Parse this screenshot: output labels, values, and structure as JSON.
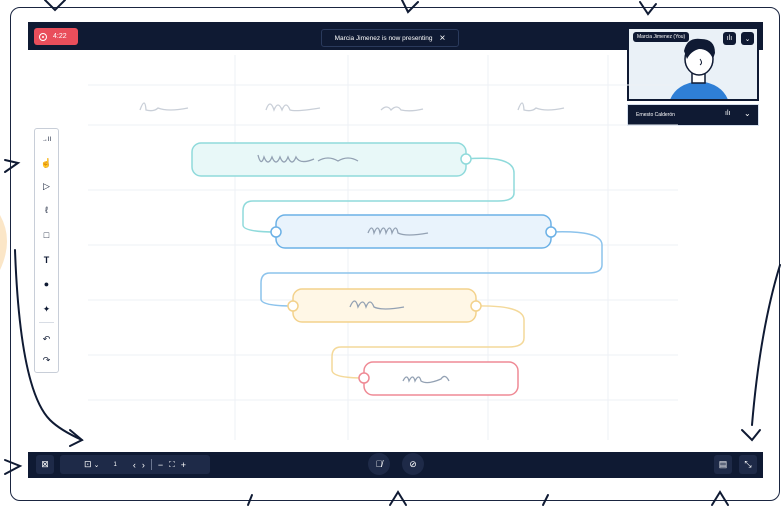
{
  "recording": {
    "time": "4:22"
  },
  "notification": {
    "text": "Marcia Jimenez is now presenting",
    "close_icon": "×"
  },
  "participants": [
    {
      "name": "Marcia Jimenez (You)"
    },
    {
      "name": "Ernesto Calderón"
    }
  ],
  "toolbar": {
    "items": [
      "→II",
      "☝",
      "▷",
      "ℓ",
      "□",
      "T",
      "●",
      "✦",
      "↶",
      "↷"
    ]
  },
  "bottom": {
    "page_number": "1",
    "prev": "‹",
    "next": "›",
    "zoom_out": "−",
    "zoom_in": "+"
  },
  "colors": {
    "bar": "#0f1a33",
    "record": "#e94e5b",
    "teal": "#7fd3d4",
    "blue": "#6cb1e6",
    "yellow": "#f3d28c",
    "red": "#ef8a95"
  }
}
